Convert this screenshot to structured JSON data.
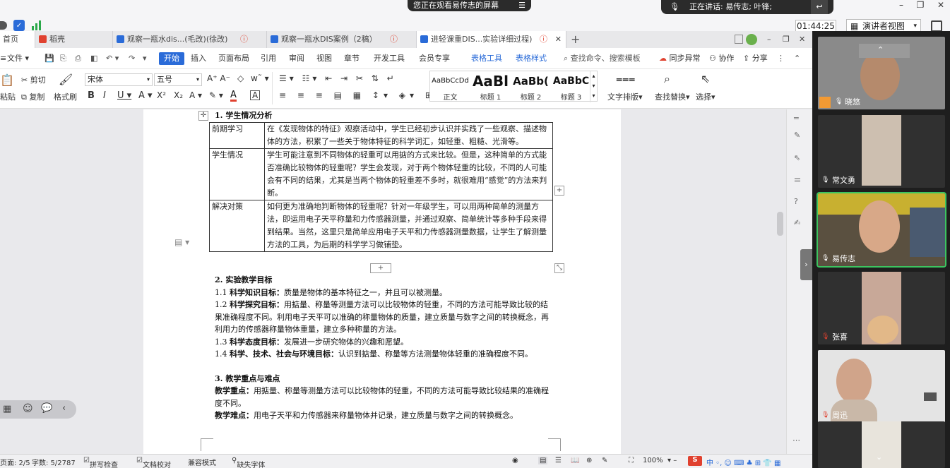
{
  "meeting": {
    "share_text": "您正在观看易传志的屏幕",
    "talk_text": "正在讲话: 易传志; 叶锋;",
    "timer": "01:44:25",
    "view_mode": "演讲者视图"
  },
  "tabs": [
    {
      "label": "首页"
    },
    {
      "label": "稻壳"
    },
    {
      "label": "观察一瓶水dis...(毛改)(徐改)"
    },
    {
      "label": "观察一瓶水DIS案例（2稿）"
    },
    {
      "label": "进轻课重DIS...实验详细过程)"
    }
  ],
  "menu": {
    "file": "文件",
    "items": [
      "开始",
      "插入",
      "页面布局",
      "引用",
      "审阅",
      "视图",
      "章节",
      "开发工具",
      "会员专享",
      "表格工具",
      "表格样式"
    ],
    "search": "查找命令、搜索模板",
    "sync": "同步异常",
    "collab": "协作",
    "share": "分享"
  },
  "ribbon": {
    "cut": "剪切",
    "copy": "复制",
    "paste": "粘贴",
    "format_painter": "格式刷",
    "font": "宋体",
    "size": "五号",
    "styles": [
      {
        "sample": "AaBbCcDd",
        "label": "正文"
      },
      {
        "sample": "AaBl",
        "label": "标题 1"
      },
      {
        "sample": "AaBb(",
        "label": "标题 2"
      },
      {
        "sample": "AaBbC",
        "label": "标题 3"
      }
    ],
    "text_layout": "文字排版",
    "find_replace": "查找替换",
    "select": "选择"
  },
  "doc": {
    "h1": "1. 学生情况分析",
    "table": [
      {
        "k": "前期学习",
        "v": "在《发现物体的特征》观察活动中，学生已经初步认识并实践了一些观察、描述物体的方法，积累了一些关于物体特征的科学词汇，如轻重、粗糙、光滑等。"
      },
      {
        "k": "学生情况",
        "v": "学生可能注意到不同物体的轻重可以用掂的方式来比较。但是，这种简单的方式能否准确比较物体的轻重呢？学生会发现，对于两个物体轻重的比较，不同的人可能会有不同的结果，尤其是当两个物体的轻重差不多时，就很难用“感觉”的方法来判断。"
      },
      {
        "k": "解决对策",
        "v": "如何更为准确地判断物体的轻重呢？针对一年级学生，可以用两种简单的测量方法，即运用电子天平称量和力传感器测量，并通过观察、简单统计等多种手段来得到结果。当然，这里只是简单应用电子天平和力传感器测量数据，让学生了解测量方法的工具，为后期的科学学习做铺垫。"
      }
    ],
    "h2": "2. 实验教学目标",
    "goals": [
      {
        "num": "1.1",
        "title": "科学知识目标：",
        "text": "质量是物体的基本特征之一，并且可以被测量。"
      },
      {
        "num": "1.2",
        "title": "科学探究目标：",
        "text": "用掂量、称量等测量方法可以比较物体的轻重，不同的方法可能导致比较的结果准确程度不同。利用电子天平可以准确的称量物体的质量，建立质量与数字之间的转换概念，再利用力的传感器称量物体重量，建立多种称量的方法。"
      },
      {
        "num": "1.3",
        "title": "科学态度目标：",
        "text": "发展进一步研究物体的兴趣和愿望。"
      },
      {
        "num": "1.4",
        "title": "科学、技术、社会与环境目标：",
        "text": "认识到掂量、称量等方法测量物体轻重的准确程度不同。"
      }
    ],
    "h3": "3. 教学重点与难点",
    "key_label": "教学重点：",
    "key_text": "用掂量、称量等测量方法可以比较物体的轻重，不同的方法可能导致比较结果的准确程度不同。",
    "diff_label": "教学难点：",
    "diff_text": "用电子天平和力传感器来称量物体并记录，建立质量与数字之间的转换概念。"
  },
  "status": {
    "page": "页面: 2/5",
    "words": "字数: 5/2787",
    "spell": "拼写检查",
    "proof": "文档校对",
    "compat": "兼容模式",
    "missing_font": "缺失字体",
    "zoom": "100%"
  },
  "participants": [
    {
      "name": "晓悠",
      "speaking": false
    },
    {
      "name": "常文勇",
      "speaking": false
    },
    {
      "name": "易传志",
      "speaking": true
    },
    {
      "name": "张喜",
      "speaking": false
    },
    {
      "name": "周迅",
      "speaking": false
    },
    {
      "name": "",
      "speaking": false
    }
  ],
  "colors": {
    "accent": "#2a6bd8",
    "speaking": "#3cc460",
    "wps_red": "#e0412f"
  }
}
